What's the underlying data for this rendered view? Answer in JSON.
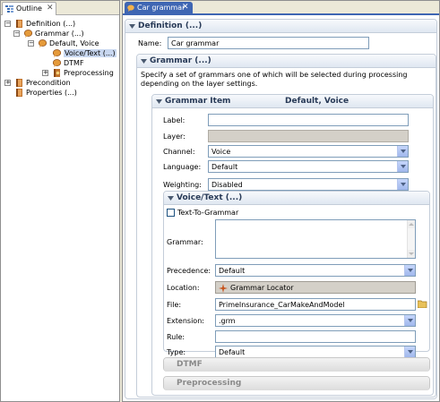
{
  "outline": {
    "tab_label": "Outline",
    "tree": [
      {
        "label": "Definition (...)",
        "expander": "-"
      },
      {
        "label": "Grammar (...)",
        "expander": "-"
      },
      {
        "label": "Default, Voice",
        "expander": "-"
      },
      {
        "label": "Voice/Text (...)",
        "expander": ""
      },
      {
        "label": "DTMF",
        "expander": ""
      },
      {
        "label": "Preprocessing",
        "expander": "+"
      },
      {
        "label": "Precondition",
        "expander": "+"
      },
      {
        "label": "Properties (...)",
        "expander": ""
      }
    ],
    "selected_item": "Voice/Text (...)"
  },
  "editor": {
    "tab_label": "Car grammar",
    "definition": {
      "heading": "Definition (...)",
      "name_label": "Name:",
      "name_value": "Car grammar"
    },
    "grammar": {
      "heading": "Grammar (...)",
      "description": "Specify a set of grammars one of which will be selected during processing depending on the layer settings.",
      "item": {
        "heading_left": "Grammar Item",
        "heading_right": "Default, Voice",
        "label_label": "Label:",
        "label_value": "",
        "layer_label": "Layer:",
        "layer_value": "",
        "channel_label": "Channel:",
        "channel_value": "Voice",
        "language_label": "Language:",
        "language_value": "Default",
        "weighting_label": "Weighting:",
        "weighting_value": "Disabled",
        "voice_text": {
          "heading": "Voice/Text (...)",
          "text_to_grammar_label": "Text-To-Grammar",
          "text_to_grammar_checked": false,
          "grammar_label": "Grammar:",
          "grammar_value": "",
          "precedence_label": "Precedence:",
          "precedence_value": "Default",
          "location_label": "Location:",
          "location_value": "Grammar Locator",
          "file_label": "File:",
          "file_value": "PrimeInsurance_CarMakeAndModel",
          "extension_label": "Extension:",
          "extension_value": ".grm",
          "rule_label": "Rule:",
          "rule_value": "",
          "type_label": "Type:",
          "type_value": "Default"
        },
        "dtmf_heading": "DTMF",
        "preprocessing_heading": "Preprocessing"
      }
    }
  },
  "colors": {
    "active_tab": "#3f66b3",
    "section_title": "#283a57",
    "selection": "#c8d7f0"
  }
}
